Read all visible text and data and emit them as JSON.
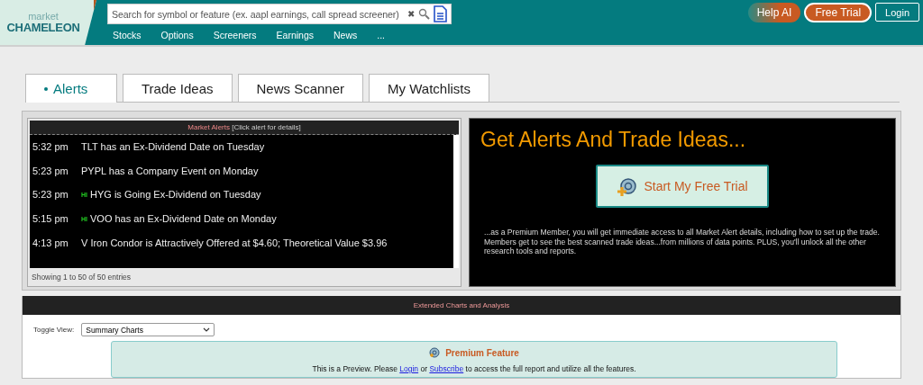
{
  "header": {
    "logo_top": "market",
    "logo_bottom": "CHAMELEON",
    "search": {
      "placeholder": "Search for symbol or feature (ex. aapl earnings, call spread screener)",
      "clear": "✖"
    },
    "nav": [
      "Stocks",
      "Options",
      "Screeners",
      "Earnings",
      "News",
      "..."
    ],
    "buttons": [
      {
        "kind": "gradient",
        "label": "Help AI"
      },
      {
        "kind": "filled",
        "label": "Free Trial"
      },
      {
        "kind": "outline",
        "label": "Login"
      }
    ]
  },
  "tabs": [
    {
      "label": "Alerts",
      "selected": true
    },
    {
      "label": "Trade Ideas",
      "selected": false
    },
    {
      "label": "News Scanner",
      "selected": false
    },
    {
      "label": "My Watchlists",
      "selected": false
    }
  ],
  "alerts": {
    "title": "Market Alerts",
    "hint": "[Click alert for details]",
    "rows": [
      {
        "time": "5:32 pm",
        "text": "TLT has an Ex-Dividend Date on Tuesday"
      },
      {
        "time": "5:23 pm",
        "text": "PYPL has a Company Event on Monday"
      },
      {
        "time": "5:23 pm",
        "badge": "HI",
        "text": "HYG is Going Ex-Dividend on Tuesday"
      },
      {
        "time": "5:15 pm",
        "badge": "HI",
        "text": "VOO has an Ex-Dividend Date on Monday"
      },
      {
        "time": "4:13 pm",
        "text": "V Iron Condor is Attractively Offered at $4.60; Theoretical Value $3.96"
      }
    ],
    "footer": "Showing 1 to 50 of 50 entries"
  },
  "promo": {
    "heading": "Get Alerts And Trade Ideas...",
    "cta": "Start My Free Trial",
    "body": "...as a Premium Member, you will get immediate access to all Market Alert details, including how to set up the trade. Members get to see the best scanned trade ideas...from millions of data points. PLUS, you'll unlock all the other research tools and reports."
  },
  "charts": {
    "title": "Extended Charts and Analysis",
    "toggle_label": "Toggle View:",
    "toggle_value": "Summary Charts",
    "premium": {
      "title": "Premium Feature",
      "lead": "This is a Preview. Please",
      "links": [
        "Login",
        "Subscribe"
      ],
      "joiner": "or",
      "tail": "to access the full report and utilize all the features."
    }
  }
}
